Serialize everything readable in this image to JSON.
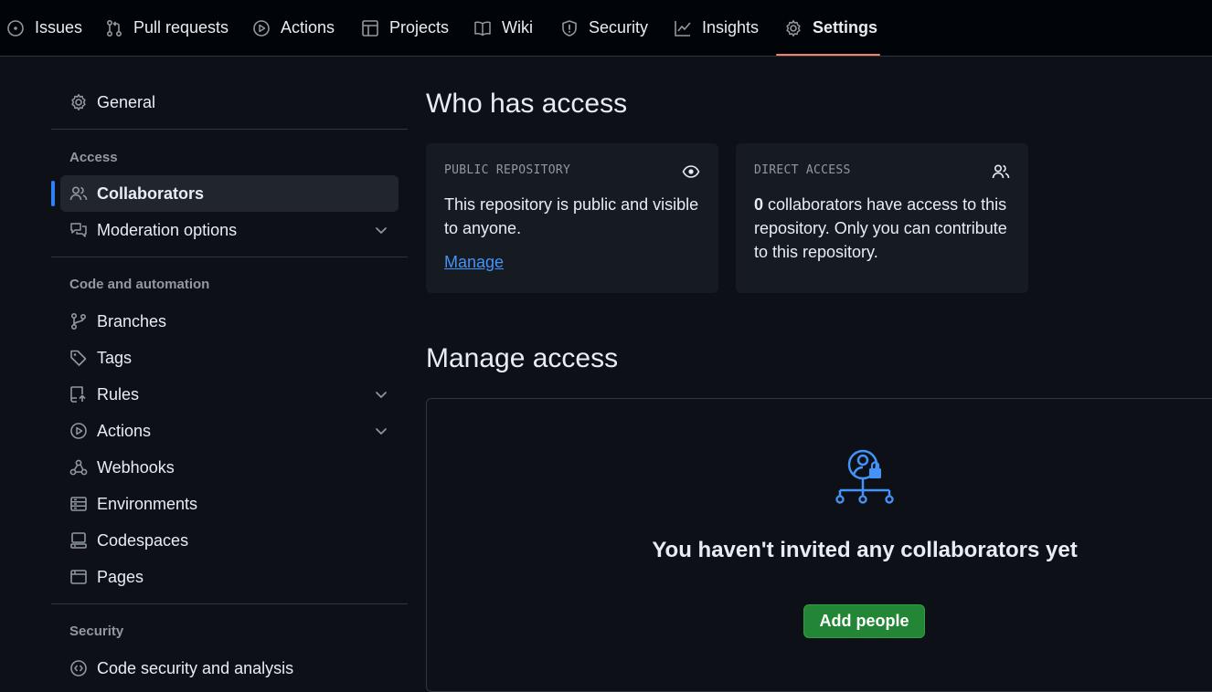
{
  "nav": {
    "tabs": [
      {
        "label": "Issues",
        "icon": "issue-opened-icon"
      },
      {
        "label": "Pull requests",
        "icon": "git-pull-request-icon"
      },
      {
        "label": "Actions",
        "icon": "play-icon"
      },
      {
        "label": "Projects",
        "icon": "table-icon"
      },
      {
        "label": "Wiki",
        "icon": "book-icon"
      },
      {
        "label": "Security",
        "icon": "shield-icon"
      },
      {
        "label": "Insights",
        "icon": "graph-icon"
      },
      {
        "label": "Settings",
        "icon": "gear-icon"
      }
    ],
    "selected": "Settings",
    "underline_color": "#f78166"
  },
  "sidebar": {
    "general": "General",
    "access_heading": "Access",
    "collaborators": "Collaborators",
    "moderation": "Moderation options",
    "code_heading": "Code and automation",
    "branches": "Branches",
    "tags": "Tags",
    "rules": "Rules",
    "actions": "Actions",
    "webhooks": "Webhooks",
    "environments": "Environments",
    "codespaces": "Codespaces",
    "pages": "Pages",
    "security_heading": "Security",
    "code_security": "Code security and analysis",
    "active_color": "#2f81f7"
  },
  "access": {
    "title": "Who has access",
    "public_card": {
      "label": "PUBLIC REPOSITORY",
      "text": "This repository is public and visible to anyone.",
      "link": "Manage"
    },
    "direct_card": {
      "label": "DIRECT ACCESS",
      "count": "0",
      "text": " collaborators have access to this repository. Only you can contribute to this repository."
    }
  },
  "manage": {
    "title": "Manage access",
    "empty_title": "You haven't invited any collaborators yet",
    "add_button": "Add people",
    "button_color": "#238636",
    "icon_color": "#4493f8"
  }
}
